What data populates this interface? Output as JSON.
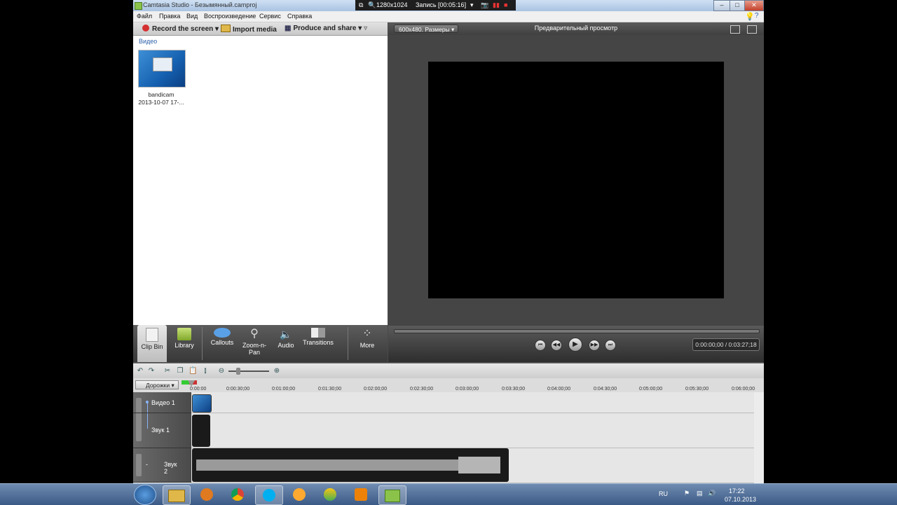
{
  "window": {
    "title": "Camtasia Studio - Безымянный.camproj"
  },
  "menu": [
    "Файл",
    "Правка",
    "Вид",
    "Воспроизведение",
    "Сервис",
    "Справка"
  ],
  "recorder": {
    "resolution": "1280x1024",
    "status": "Запись [00:05:16]"
  },
  "toolbar": {
    "record": "Record the screen",
    "import": "Import media",
    "produce": "Produce and share"
  },
  "clipbin": {
    "header": "Видео",
    "clip_name": "bandicam",
    "clip_date": "2013-10-07 17-..."
  },
  "tasks": [
    {
      "label": "Clip Bin",
      "icon": "clip-bin-icon"
    },
    {
      "label": "Library",
      "icon": "library-icon"
    },
    {
      "label": "Callouts",
      "icon": "callouts-icon"
    },
    {
      "label": "Zoom-n-Pan",
      "icon": "zoom-icon"
    },
    {
      "label": "Audio",
      "icon": "audio-icon"
    },
    {
      "label": "Transitions",
      "icon": "transitions-icon"
    },
    {
      "label": "More",
      "icon": "more-icon"
    }
  ],
  "preview": {
    "size": "600x480. Размеры",
    "title": "Предварительный просмотр",
    "timecode": "0:00:00;00 / 0:03:27;18"
  },
  "timeline": {
    "tracks_button": "Дорожки",
    "ticks": [
      "0:00:00",
      "0:00:30;00",
      "0:01:00;00",
      "0:01:30;00",
      "0:02:00;00",
      "0:02:30;00",
      "0:03:00;00",
      "0:03:30;00",
      "0:04:00;00",
      "0:04:30;00",
      "0:05:00;00",
      "0:05:30;00",
      "0:06:00;00"
    ],
    "tracks": [
      {
        "name": "Видео 1"
      },
      {
        "name": "Звук 1"
      },
      {
        "name": "Звук 2"
      }
    ]
  },
  "taskbar": {
    "lang": "RU",
    "time": "17:22",
    "date": "07.10.2013"
  },
  "colors": {
    "accent": "#2a5ea8",
    "record": "#d43030",
    "dark": "#4a4a4a"
  }
}
